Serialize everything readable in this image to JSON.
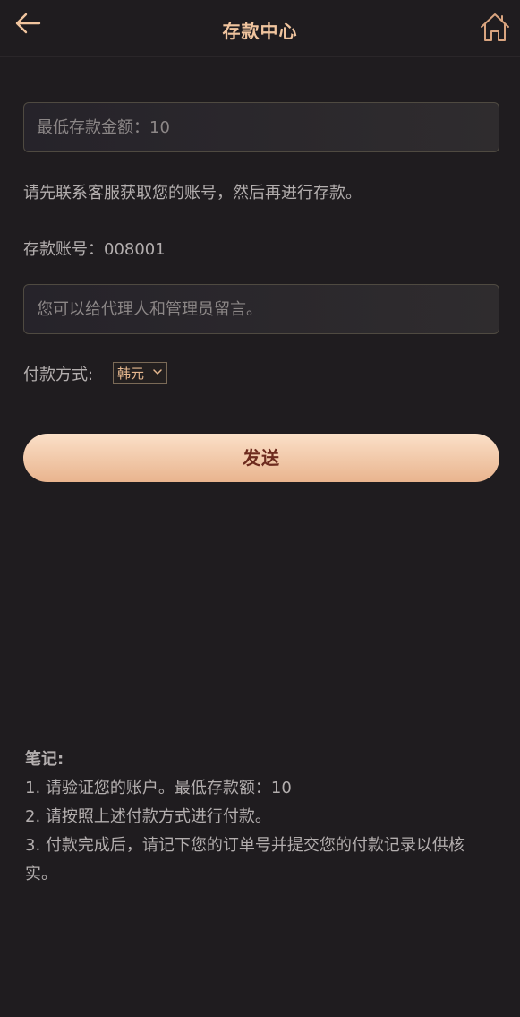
{
  "header": {
    "title": "存款中心",
    "back_icon": "arrow-left-icon",
    "home_icon": "home-icon"
  },
  "form": {
    "min_amount_placeholder": "最低存款金额：10",
    "instruction": "请先联系客服获取您的账号，然后再进行存款。",
    "account_text": "存款账号：008001",
    "message_placeholder": "您可以给代理人和管理员留言。",
    "payment_label": "付款方式:",
    "payment_selected": "韩元",
    "send_label": "发送"
  },
  "notes": {
    "title": "笔记:",
    "items": [
      "1. 请验证您的账户。最低存款额：10",
      "2. 请按照上述付款方式进行付款。",
      "3. 付款完成后，请记下您的订单号并提交您的付款记录以供核实。"
    ]
  },
  "colors": {
    "background": "#1f1c1f",
    "accent": "#f0c49e",
    "button_text": "#6d2b1e"
  }
}
